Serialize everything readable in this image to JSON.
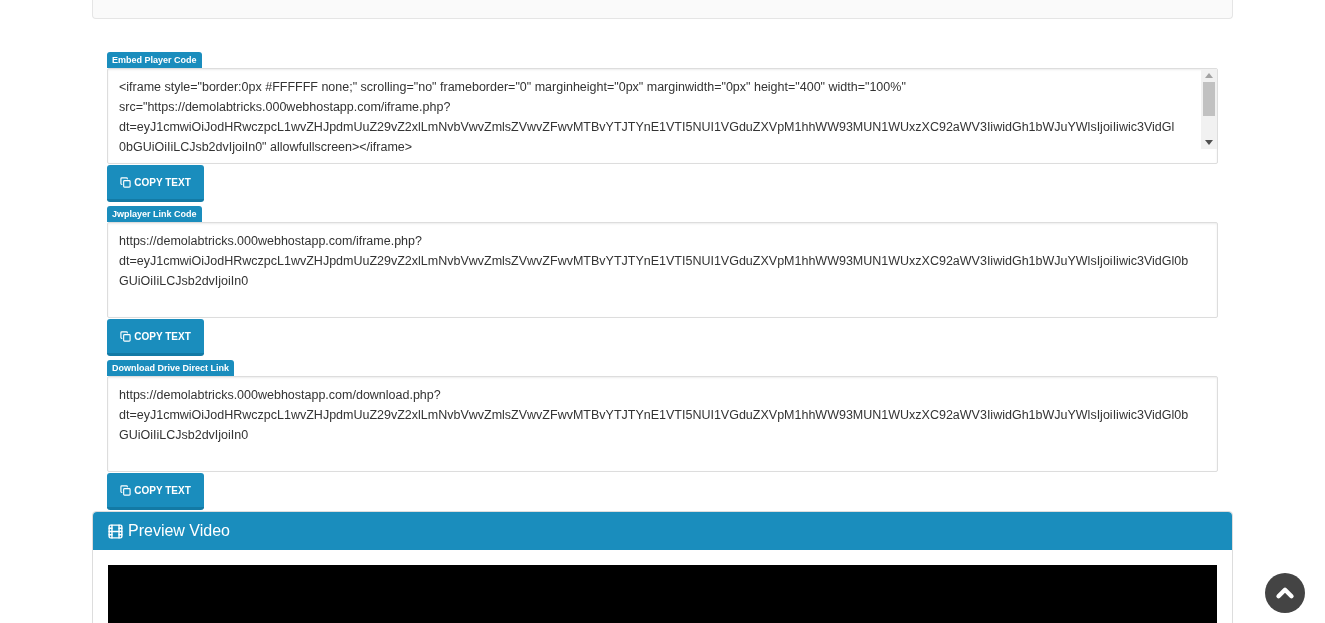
{
  "sections": [
    {
      "label": "Embed Player Code",
      "has_scrollbar": true,
      "lines": [
        "<iframe style=\"border:0px #FFFFFF none;\" scrolling=\"no\" frameborder=\"0\" marginheight=\"0px\" marginwidth=\"0px\" height=\"400\" width=\"100%\"",
        "src=\"https://demolabtricks.000webhostapp.com/iframe.php?",
        "dt=eyJ1cmwiOiJodHRwczpcL1wvZHJpdmUuZ29vZ2xlLmNvbVwvZmlsZVwvZFwvMTBvYTJTYnE1VTI5NUI1VGduZXVpM1hhWW93MUN1WUxzXC92aWV3IiwidGh1bWJuYWlsIjoiIiwic3VidGl",
        "0bGUiOiIiLCJsb2dvIjoiIn0\" allowfullscreen></iframe>"
      ],
      "button": "COPY TEXT"
    },
    {
      "label": "Jwplayer Link Code",
      "has_scrollbar": false,
      "lines": [
        "https://demolabtricks.000webhostapp.com/iframe.php?",
        "dt=eyJ1cmwiOiJodHRwczpcL1wvZHJpdmUuZ29vZ2xlLmNvbVwvZmlsZVwvZFwvMTBvYTJTYnE1VTI5NUI1VGduZXVpM1hhWW93MUN1WUxzXC92aWV3IiwidGh1bWJuYWlsIjoiIiwic3VidGl0b",
        "GUiOiIiLCJsb2dvIjoiIn0"
      ],
      "button": "COPY TEXT"
    },
    {
      "label": "Download Drive Direct Link",
      "has_scrollbar": false,
      "lines": [
        "https://demolabtricks.000webhostapp.com/download.php?",
        "dt=eyJ1cmwiOiJodHRwczpcL1wvZHJpdmUuZ29vZ2xlLmNvbVwvZmlsZVwvZFwvMTBvYTJTYnE1VTI5NUI1VGduZXVpM1hhWW93MUN1WUxzXC92aWV3IiwidGh1bWJuYWlsIjoiIiwic3VidGl0b",
        "GUiOiIiLCJsb2dvIjoiIn0"
      ],
      "button": "COPY TEXT"
    }
  ],
  "preview": {
    "title": "Preview Video"
  }
}
